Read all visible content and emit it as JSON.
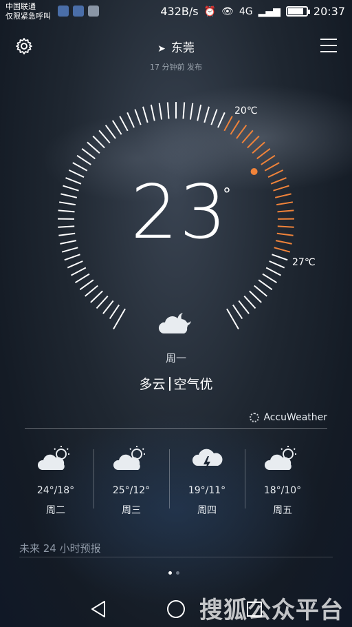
{
  "statusbar": {
    "carrier_line1": "中国联通",
    "carrier_line2": "仅限紧急呼叫",
    "net_speed": "432B/s",
    "signal_label": "4G",
    "time": "20:37"
  },
  "header": {
    "city": "东莞",
    "published": "17 分钟前 发布"
  },
  "current": {
    "temperature": "23",
    "degree_symbol": "°",
    "high_label": "20℃",
    "low_label": "27℃",
    "day": "周一",
    "condition": "多云",
    "air_quality": "空气优",
    "icon": "cloudy-night-icon"
  },
  "provider": "AccuWeather",
  "forecast": [
    {
      "range": "24°/18°",
      "day": "周二",
      "icon": "partly-cloudy-icon"
    },
    {
      "range": "25°/12°",
      "day": "周三",
      "icon": "partly-cloudy-icon"
    },
    {
      "range": "19°/11°",
      "day": "周四",
      "icon": "thunderstorm-icon"
    },
    {
      "range": "18°/10°",
      "day": "周五",
      "icon": "partly-cloudy-icon"
    }
  ],
  "hourly_title": "未来 24 小时预报",
  "watermark": "搜狐公众平台",
  "colors": {
    "accent": "#f0833a",
    "background": "#1a222d"
  }
}
